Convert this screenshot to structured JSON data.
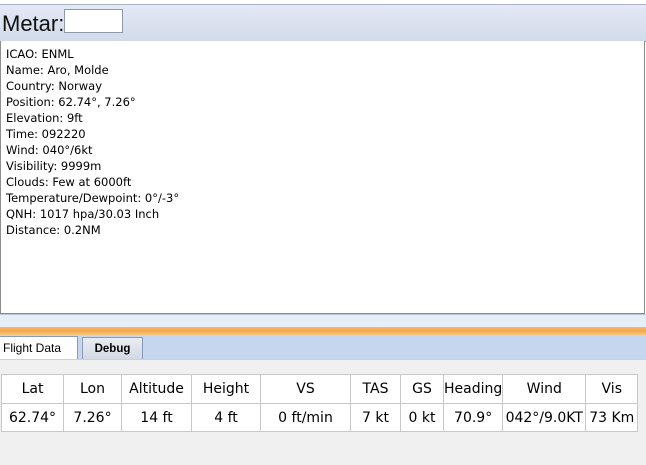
{
  "metar": {
    "label": "Metar:",
    "input_value": ""
  },
  "info": {
    "lines": [
      "ICAO: ENML",
      "Name: Aro, Molde",
      "Country: Norway",
      "Position: 62.74°, 7.26°",
      "Elevation: 9ft",
      "Time: 092220",
      "Wind: 040°/6kt",
      "Visibility: 9999m",
      "Clouds: Few at 6000ft",
      "Temperature/Dewpoint: 0°/-3°",
      "QNH: 1017 hpa/30.03 Inch",
      "Distance: 0.2NM"
    ]
  },
  "tabs": [
    {
      "label": "Flight Data"
    },
    {
      "label": "Debug"
    }
  ],
  "flight_table": {
    "headers": [
      "Lat",
      "Lon",
      "Altitude",
      "Height",
      "VS",
      "TAS",
      "GS",
      "Heading",
      "Wind",
      "Vis"
    ],
    "row": [
      "62.74°",
      "7.26°",
      "14 ft",
      "4 ft",
      "0 ft/min",
      "7 kt",
      "0 kt",
      "70.9°",
      "042°/9.0KT",
      "73 Km"
    ]
  }
}
